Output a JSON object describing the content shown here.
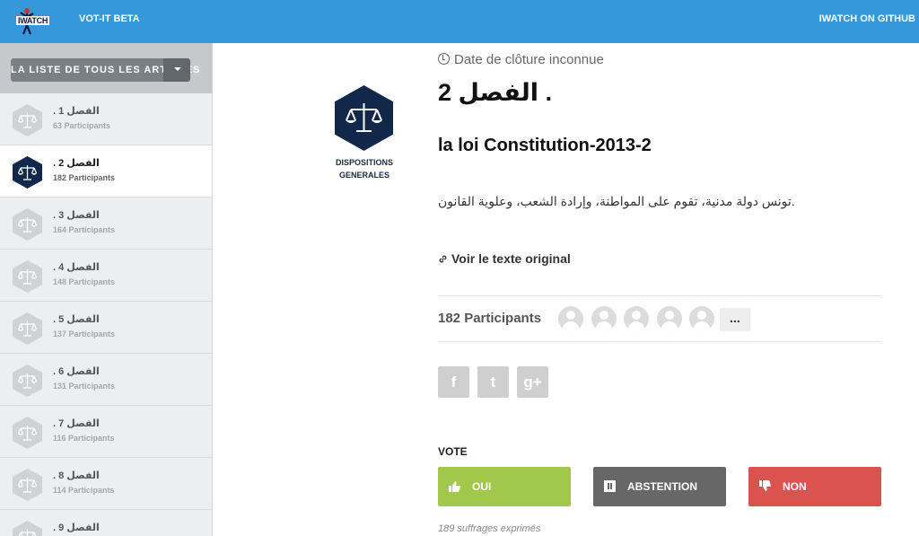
{
  "topbar": {
    "logo_text": "IWATCH",
    "brand": "VOT-IT BETA",
    "github_link": "IWATCH ON GITHUB"
  },
  "sidebar": {
    "dropdown_label": "LA LISTE DE TOUS LES ARTICLES",
    "chapters": [
      {
        "title": "الفصل 1 .",
        "participants": "63 Participants",
        "active": false
      },
      {
        "title": "الفصل 2 .",
        "participants": "182 Participants",
        "active": true
      },
      {
        "title": "الفصل 3 .",
        "participants": "164 Participants",
        "active": false
      },
      {
        "title": "الفصل 4 .",
        "participants": "148 Participants",
        "active": false
      },
      {
        "title": "الفصل 5 .",
        "participants": "137 Participants",
        "active": false
      },
      {
        "title": "الفصل 6 .",
        "participants": "131 Participants",
        "active": false
      },
      {
        "title": "الفصل 7 .",
        "participants": "116 Participants",
        "active": false
      },
      {
        "title": "الفصل 8 .",
        "participants": "114 Participants",
        "active": false
      },
      {
        "title": "الفصل 9 .",
        "participants": "",
        "active": false
      }
    ]
  },
  "main": {
    "category_line1": "DISPOSITIONS",
    "category_line2": "GENERALES",
    "date_text": "Date de clôture inconnue",
    "title": "الفصل 2 .",
    "subtitle": "la loi Constitution-2013-2",
    "article_text": "تونس دولة مدنية، تقوم على المواطنة، وإرادة الشعب، وعلوية القانون.",
    "original_link": "Voir le texte original",
    "participants_label": "182 Participants",
    "more_label": "...",
    "share": {
      "facebook": "f",
      "twitter": "t",
      "googleplus": "g+"
    },
    "vote_label": "VOTE",
    "vote_buttons": {
      "oui": "OUI",
      "abstention": "ABSTENTION",
      "non": "NON"
    },
    "suffrages": "189 suffrages exprimés"
  },
  "colors": {
    "topbar": "#3498db",
    "hex_active": "#12284a",
    "hex_inactive": "#cfd3d6",
    "oui": "#a1c84a",
    "abstention": "#676767",
    "non": "#d9534f"
  },
  "icons": {
    "clock": "clock-icon",
    "link": "link-icon",
    "scales": "scales-icon",
    "thumbs_up": "thumbs-up-icon",
    "pause": "pause-icon",
    "thumbs_down": "thumbs-down-icon"
  }
}
